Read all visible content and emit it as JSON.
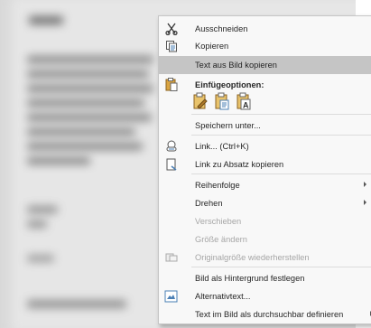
{
  "menu": {
    "items": [
      {
        "label": "Ausschneiden",
        "icon": "scissors-icon",
        "enabled": true
      },
      {
        "label": "Kopieren",
        "icon": "copy-icon",
        "enabled": true
      },
      {
        "label": "Text aus Bild kopieren",
        "icon": "",
        "enabled": true,
        "highlighted": true
      },
      {
        "label": "Einfügeoptionen:",
        "icon": "clipboard-icon",
        "header": true
      },
      {
        "label": "Speichern unter...",
        "icon": "",
        "enabled": true
      },
      {
        "label": "Link... (Ctrl+K)",
        "icon": "link-icon",
        "enabled": true
      },
      {
        "label": "Link zu Absatz kopieren",
        "icon": "link-paragraph-icon",
        "enabled": true
      },
      {
        "label": "Reihenfolge",
        "icon": "",
        "enabled": true,
        "submenu": true
      },
      {
        "label": "Drehen",
        "icon": "",
        "enabled": true,
        "submenu": true
      },
      {
        "label": "Verschieben",
        "icon": "",
        "enabled": false
      },
      {
        "label": "Größe ändern",
        "icon": "",
        "enabled": false
      },
      {
        "label": "Originalgröße wiederherstellen",
        "icon": "reset-size-icon",
        "enabled": false
      },
      {
        "label": "Bild als Hintergrund festlegen",
        "icon": "",
        "enabled": true
      },
      {
        "label": "Alternativtext...",
        "icon": "alt-text-icon",
        "enabled": true
      },
      {
        "label": "Text im Bild als durchsuchbar definieren",
        "icon": "",
        "enabled": true,
        "submenu": true
      }
    ],
    "paste_options": [
      "keep-source-formatting-icon",
      "merge-formatting-icon",
      "keep-text-only-icon"
    ],
    "paste_text_only_glyph": "A"
  },
  "colors": {
    "highlight": "#c5c5c5",
    "disabled_text": "#a6a6a6",
    "menu_bg": "#f8f8f8"
  }
}
